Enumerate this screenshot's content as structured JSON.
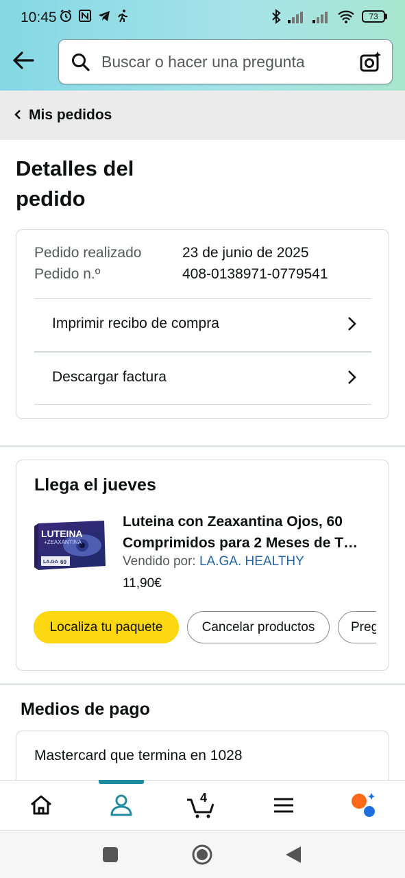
{
  "status_bar": {
    "time": "10:45",
    "battery": "73"
  },
  "search": {
    "placeholder": "Buscar o hacer una pregunta"
  },
  "breadcrumb": {
    "label": "Mis pedidos"
  },
  "page_title": "Detalles del pedido",
  "order_info": {
    "placed_label": "Pedido realizado",
    "placed_value": "23 de junio de 2025",
    "number_label": "Pedido n.º",
    "number_value": "408-0138971-0779541",
    "links": [
      {
        "label": "Imprimir recibo de compra"
      },
      {
        "label": "Descargar factura"
      }
    ]
  },
  "shipment": {
    "heading": "Llega el jueves",
    "product": {
      "title": "Luteina con Zeaxantina Ojos, 60 Comprimidos para 2 Meses de T…",
      "seller_prefix": "Vendido por:",
      "seller_name": "LA.GA. HEALTHY",
      "price": "11,90€",
      "image_text": {
        "brand": "LUTEINA",
        "sub": "+ZEAXANTINA",
        "maker": "LA.GA",
        "count": "60"
      }
    },
    "actions": [
      {
        "label": "Localiza tu paquete"
      },
      {
        "label": "Cancelar productos"
      },
      {
        "label": "Preg"
      }
    ]
  },
  "payment": {
    "heading": "Medios de pago",
    "method": "Mastercard  que termina en 1028"
  },
  "bottom_nav": {
    "cart_count": "4",
    "items": [
      "home-icon",
      "account-icon",
      "cart-icon",
      "menu-icon",
      "ai-assistant-icon"
    ]
  },
  "colors": {
    "accent": "#1f8aa0",
    "primary_button": "#ffd814",
    "link": "#2162a1"
  }
}
